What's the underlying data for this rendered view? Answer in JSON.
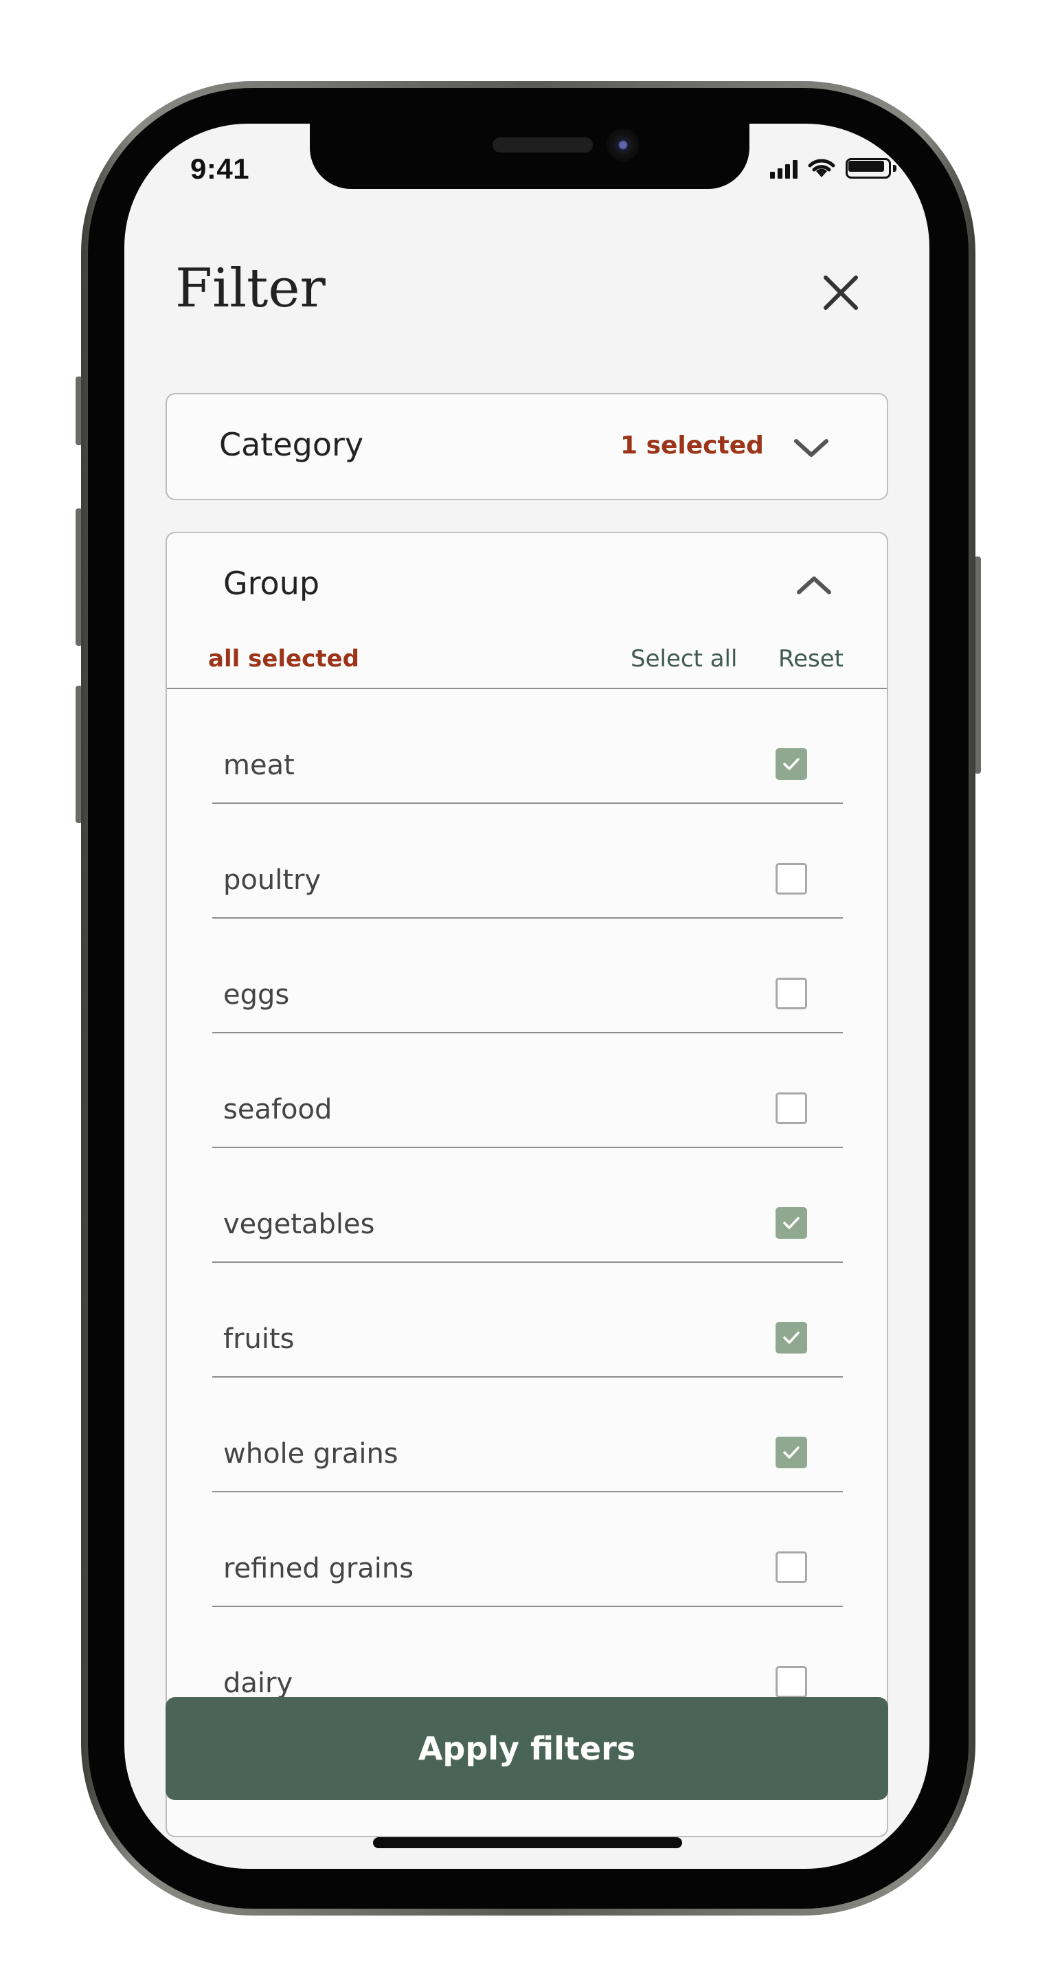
{
  "status": {
    "time": "9:41"
  },
  "header": {
    "title": "Filter",
    "close_icon": "close-icon"
  },
  "category": {
    "label": "Category",
    "count": "1 selected",
    "expanded": false
  },
  "group": {
    "label": "Group",
    "status": "all selected",
    "select_all": "Select all",
    "reset": "Reset",
    "expanded": true,
    "items": [
      {
        "label": "meat",
        "checked": true
      },
      {
        "label": "poultry",
        "checked": false
      },
      {
        "label": "eggs",
        "checked": false
      },
      {
        "label": "seafood",
        "checked": false
      },
      {
        "label": "vegetables",
        "checked": true
      },
      {
        "label": "fruits",
        "checked": true
      },
      {
        "label": "whole grains",
        "checked": true
      },
      {
        "label": "refined grains",
        "checked": false
      },
      {
        "label": "dairy",
        "checked": false
      }
    ]
  },
  "apply_button": "Apply filters",
  "colors": {
    "accent_red": "#9b3418",
    "primary_green": "#4a6558",
    "checkbox_green": "#8fa88f",
    "background": "#f4f4f4"
  }
}
